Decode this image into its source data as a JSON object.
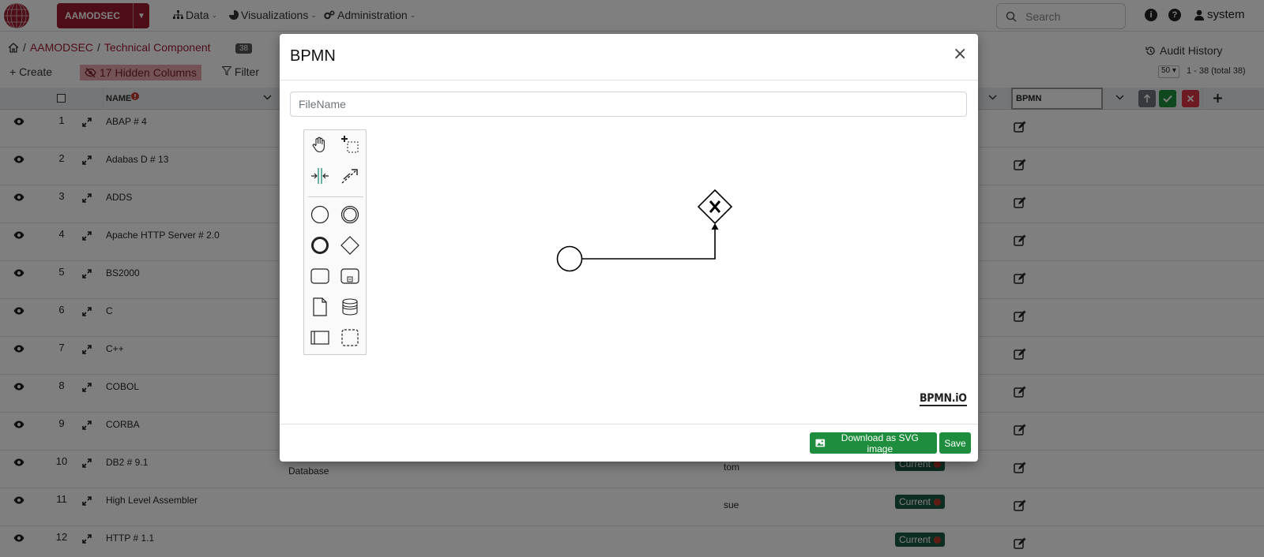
{
  "navbar": {
    "brand_label": "AAMODSEC",
    "menus": [
      {
        "label": "Data",
        "icon": "sitemap-icon"
      },
      {
        "label": "Visualizations",
        "icon": "chart-pie-icon"
      },
      {
        "label": "Administration",
        "icon": "cogs-icon"
      }
    ],
    "search_placeholder": "Search",
    "user_name": "system",
    "info_glyph": "i",
    "help_glyph": "?"
  },
  "breadcrumb": {
    "separator": "/",
    "app": "AAMODSEC",
    "page": "Technical Component",
    "count": "38"
  },
  "audit_history_label": "Audit History",
  "toolbar": {
    "create_label": "+ Create",
    "hidden_columns_label": "17 Hidden Columns",
    "filter_label": "Filter",
    "page_size": "50",
    "range_text": "1 - 38 (total 38)"
  },
  "grid": {
    "name_header": "NAME",
    "bpmn_header": "BPMN",
    "rows": [
      {
        "num": "1",
        "name": "ABAP # 4",
        "category": "",
        "owner": "",
        "status": ""
      },
      {
        "num": "2",
        "name": "Adabas D # 13",
        "category": "",
        "owner": "",
        "status": ""
      },
      {
        "num": "3",
        "name": "ADDS",
        "category": "",
        "owner": "",
        "status": ""
      },
      {
        "num": "4",
        "name": "Apache HTTP Server # 2.0",
        "category": "",
        "owner": "",
        "status": ""
      },
      {
        "num": "5",
        "name": "BS2000",
        "category": "",
        "owner": "",
        "status": ""
      },
      {
        "num": "6",
        "name": "C",
        "category": "",
        "owner": "",
        "status": ""
      },
      {
        "num": "7",
        "name": "C++",
        "category": "",
        "owner": "",
        "status": ""
      },
      {
        "num": "8",
        "name": "COBOL",
        "category": "",
        "owner": "",
        "status": ""
      },
      {
        "num": "9",
        "name": "CORBA",
        "category": "",
        "owner": "",
        "status": ""
      },
      {
        "num": "10",
        "name": "DB2 # 9.1",
        "category": "Database",
        "owner": "tom",
        "status": "Current"
      },
      {
        "num": "11",
        "name": "High Level Assembler",
        "category": "",
        "owner": "sue",
        "status": "Current"
      },
      {
        "num": "12",
        "name": "HTTP # 1.1",
        "category": "",
        "owner": "",
        "status": "Current"
      }
    ]
  },
  "modal": {
    "title": "BPMN",
    "close_glyph": "×",
    "filename_placeholder": "FileName",
    "watermark": "BPMN.iO",
    "download_label": "Download as SVG image",
    "save_label": "Save"
  },
  "colors": {
    "brand": "#9b1c2e",
    "success": "#1e8e3e",
    "status_badge": "#1d5b45",
    "danger": "#dc3545"
  }
}
